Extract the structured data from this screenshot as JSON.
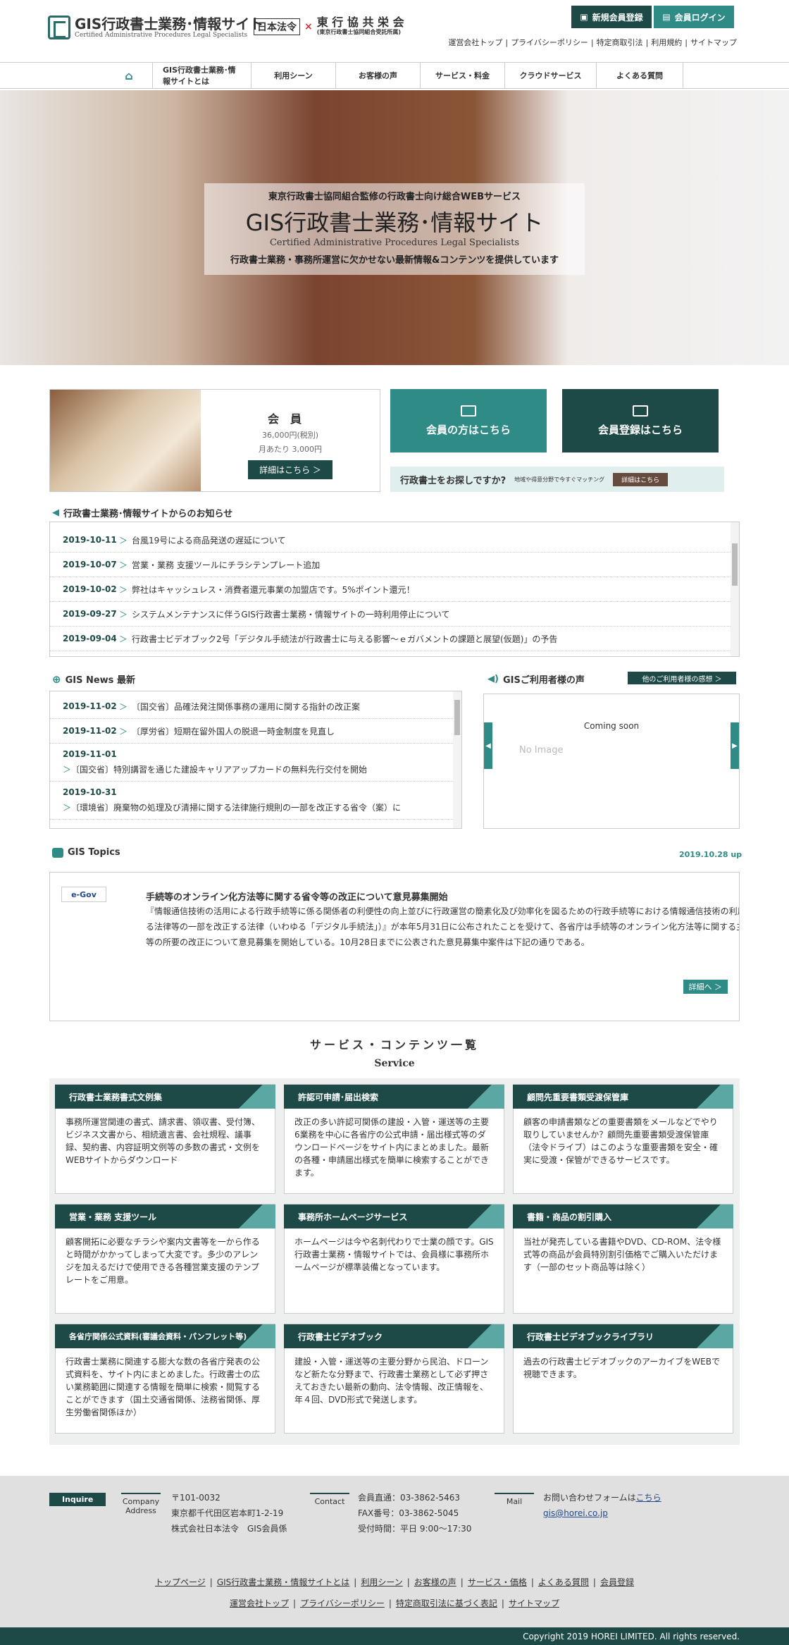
{
  "header": {
    "logo_title": "GIS行政書士業務･情報サイト",
    "logo_subtitle": "Certified Administrative Procedures Legal Specialists",
    "partner1": "日本法令",
    "partner_x": "×",
    "partner2": "東 行 協 共 栄 会",
    "partner2_sub": "(東京行政書士協同組合受託所属)",
    "btn_register": "新規会員登録",
    "btn_login": "会員ログイン",
    "util_links": [
      "運営会社トップ",
      "プライバシーポリシー",
      "特定商取引法",
      "利用規約",
      "サイトマップ"
    ]
  },
  "nav": [
    "GIS行政書士業務･情報サイトとは",
    "利用シーン",
    "お客様の声",
    "サービス・料金",
    "クラウドサービス",
    "よくある質問"
  ],
  "hero": {
    "sub": "東京行政書士協同組合監修の行政書士向け総合WEBサービス",
    "title": "GIS行政書士業務･情報サイト",
    "en": "Certified Administrative Procedures Legal Specialists",
    "tagline": "行政書士業務・事務所運営に欠かせない最新情報&コンテンツを提供しています"
  },
  "member": {
    "title": "会員",
    "price1": "36,000円(税別)",
    "price2": "月あたり 3,000円",
    "detail_btn": "詳細はこちら ＞",
    "cta_member": "会員の方はこちら",
    "cta_register": "会員登録はこちら",
    "find_text": "行政書士をお探しですか?",
    "find_sub": "地域や得意分野で今すぐマッチング",
    "find_btn": "詳細はこちら"
  },
  "notice": {
    "heading": "行政書士業務･情報サイトからのお知らせ",
    "items": [
      {
        "date": "2019-10-11",
        "text": "台風19号による商品発送の遅延について"
      },
      {
        "date": "2019-10-07",
        "text": "営業・業務 支援ツールにチラシテンプレート追加"
      },
      {
        "date": "2019-10-02",
        "text": "弊社はキャッシュレス・消費者還元事業の加盟店です。5%ポイント還元！"
      },
      {
        "date": "2019-09-27",
        "text": "システムメンテナンスに伴うGIS行政書士業務・情報サイトの一時利用停止について"
      },
      {
        "date": "2019-09-04",
        "text": "行政書士ビデオブック2号「デジタル手続法が行政書士に与える影響～ｅガバメントの課題と展望(仮題)」の予告"
      }
    ]
  },
  "news": {
    "heading": "GIS News 最新",
    "items": [
      {
        "date": "2019-11-02",
        "text": "〔国交省〕品確法発注関係事務の運用に関する指針の改正案"
      },
      {
        "date": "2019-11-02",
        "text": "〔厚労省〕短期在留外国人の脱退一時金制度を見直し"
      },
      {
        "date": "2019-11-01",
        "text": "〔国交省〕特別講習を通じた建設キャリアアップカードの無料先行交付を開始"
      },
      {
        "date": "2019-10-31",
        "text": "〔環境省〕廃棄物の処理及び清掃に関する法律施行規則の一部を改正する省令（案）に"
      }
    ]
  },
  "voice": {
    "heading": "GISご利用者様の声",
    "btn": "他のご利用者様の感想 ＞",
    "coming": "Coming soon",
    "noimage": "No Image"
  },
  "topics": {
    "heading": "GIS Topics",
    "date": "2019.10.28 up",
    "logo": "e-Gov",
    "title": "手続等のオンライン化方法等に関する省令等の改正について意見募集開始",
    "body": "『情報通信技術の活用による行政手続等に係る関係者の利便性の向上並びに行政運営の簡素化及び効率化を図るための行政手続等における情報通信技術の利用に関する法律等の一部を改正する法律（いわゆる「デジタル手続法」）』が本年5月31日に公布されたことを受けて、各省庁は手続等のオンライン化方法等に関する主務省令等の所要の改正について意見募集を開始している。10月28日までに公表された意見募集中案件は下記の通りである。",
    "more": "詳細へ ＞"
  },
  "services": {
    "title": "サービス・コンテンツ一覧",
    "title_en": "Service",
    "cards": [
      {
        "title": "行政書士業務書式文例集",
        "desc": "事務所運営関連の書式、請求書、領収書、受付簿、ビジネス文書から、相続遺言書、会社規程、議事録、契約書、内容証明文例等の多数の書式・文例をWEBサイトからダウンロード"
      },
      {
        "title": "許認可申請･届出検索",
        "desc": "改正の多い許認可関係の建設・入管・運送等の主要6業務を中心に各省庁の公式申請・届出様式等のダウンロードページをサイト内にまとめました。最新の各種・申請届出様式を簡単に検索することができます。"
      },
      {
        "title": "顧問先重要書類受渡保管庫",
        "desc": "顧客の申請書類などの重要書類をメールなどでやり取りしていませんか？顧問先重要書類受渡保管庫（法令ドライブ）はこのような重要書類を安全・確実に受渡・保管ができるサービスです。"
      },
      {
        "title": "営業・業務 支援ツール",
        "desc": "顧客開拓に必要なチラシや案内文書等を一から作ると時間がかかってしまって大変です。多少のアレンジを加えるだけで使用できる各種営業支援のテンプレートをご用意。"
      },
      {
        "title": "事務所ホームページサービス",
        "desc": "ホームページは今や名刺代わりで士業の顔です。GIS行政書士業務・情報サイトでは、会員様に事務所ホームページが標準装備となっています。"
      },
      {
        "title": "書籍・商品の割引購入",
        "desc": "当社が発売している書籍やDVD、CD-ROM、法令様式等の商品が会員特別割引価格でご購入いただけます（一部のセット商品等は除く）"
      },
      {
        "title": "各省庁関係公式資料(審議会資料・パンフレット等)",
        "desc": "行政書士業務に関連する膨大な数の各省庁発表の公式資料を、サイト内にまとめました。行政書士の広い業務範囲に関連する情報を簡単に検索・閲覧することができます（国土交通省関係、法務省関係、厚生労働省関係ほか）"
      },
      {
        "title": "行政書士ビデオブック",
        "desc": "建設・入管・運送等の主要分野から民泊、ドローンなど新たな分野まで、行政書士業務として必ず押さえておきたい最新の動向、法令情報、改正情報を、年４回、DVD形式で発送します。"
      },
      {
        "title": "行政書士ビデオブックライブラリ",
        "desc": "過去の行政書士ビデオブックのアーカイブをWEBで視聴できます。"
      }
    ]
  },
  "footer": {
    "inquire": "Inquire",
    "company_label": "Company Address",
    "address": [
      "〒101-0032",
      "東京都千代田区岩本町1-2-19",
      "株式会社日本法令　GIS会員係"
    ],
    "contact_label": "Contact",
    "contact": [
      "会員直通：03-3862-5463",
      "FAX番号：03-3862-5045",
      "受付時間：平日 9:00～17:30"
    ],
    "mail_label": "Mail",
    "mail_text": "お問い合わせフォームは",
    "mail_link": "こちら",
    "email": "gis@horei.co.jp",
    "links1": [
      "トップページ",
      "GIS行政書士業務・情報サイトとは",
      "利用シーン",
      "お客様の声",
      "サービス・価格",
      "よくある質問",
      "会員登録"
    ],
    "links2": [
      "運営会社トップ",
      "プライバシーポリシー",
      "特定商取引法に基づく表記",
      "サイトマップ"
    ],
    "copyright": "Copyright 2019 HOREI LIMITED. All rights reserved."
  },
  "colors": {
    "dark_teal": "#1d4a47",
    "teal": "#2e8b86"
  }
}
